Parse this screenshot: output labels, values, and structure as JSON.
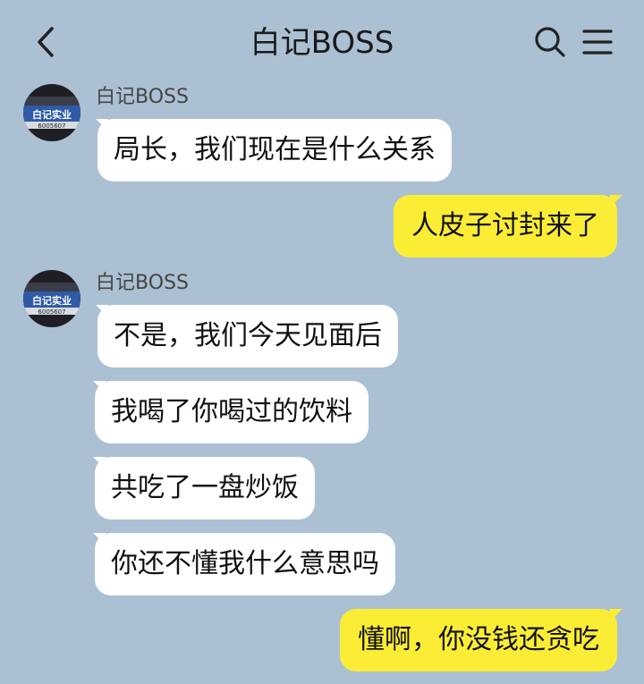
{
  "header": {
    "title": "白记BOSS",
    "back_icon": "chevron-left-icon",
    "search_icon": "search-icon",
    "menu_icon": "menu-icon"
  },
  "avatar": {
    "label": "白记实业",
    "sub": "6005607"
  },
  "messages": [
    {
      "sender": "白记BOSS",
      "text": "局长，我们现在是什么关系",
      "side": "in"
    },
    {
      "text": "人皮子讨封来了",
      "side": "out"
    },
    {
      "sender": "白记BOSS",
      "text": "不是，我们今天见面后",
      "side": "in"
    },
    {
      "text": "我喝了你喝过的饮料",
      "side": "in"
    },
    {
      "text": "共吃了一盘炒饭",
      "side": "in"
    },
    {
      "text": "你还不懂我什么意思吗",
      "side": "in"
    },
    {
      "text": "懂啊，你没钱还贪吃",
      "side": "out"
    }
  ],
  "colors": {
    "background": "#abc0d2",
    "incoming_bubble": "#ffffff",
    "outgoing_bubble": "#fbed36"
  }
}
